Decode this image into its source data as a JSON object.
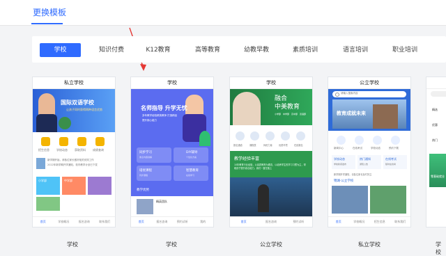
{
  "header": {
    "tab": "更换模板"
  },
  "filters": [
    "学校",
    "知识付费",
    "K12教育",
    "高等教育",
    "幼教早教",
    "素质培训",
    "语言培训",
    "职业培训"
  ],
  "cards": [
    {
      "title": "私立学校",
      "banner_title": "国际双语学校",
      "banner_sub": "让孩子同时获得两种语言优势",
      "icons": [
        "招生信息",
        "学校动态",
        "获取资料",
        "成绩查询"
      ],
      "news_line1": "新学期开始，请各位家长做好相关安排工作",
      "news_line2": "2022年新学期开学通知，校内教学计划已下发",
      "tiles": [
        "小学部",
        "中学部",
        "",
        ""
      ],
      "nav": [
        "首页",
        "学校概况",
        "报名咨询",
        "联系我们"
      ]
    },
    {
      "title": "学校",
      "banner_title": "名师指导 升学无忧",
      "banner_sub1": "多年教学经验精英教师 打造精品",
      "banner_sub2": "提升核心能力",
      "grid": [
        "同步学习",
        "DIY辅导",
        "培优课程",
        "智慧教育"
      ],
      "grid_sub": [
        "重点内容讲解",
        "个性化方案",
        "同步课程",
        "在线学习"
      ],
      "section": "教学优势",
      "team": "精英团队",
      "nav": [
        "首页",
        "报名咨询",
        "预约试听",
        "我的"
      ]
    },
    {
      "title": "学校",
      "banner_big1": "融合",
      "banner_big2": "中美教育",
      "banner_tags": [
        "小学部",
        "中学部",
        "高中部",
        "双语部"
      ],
      "icons": [
        "报名通道",
        "课程表",
        "师资力量",
        "优质环境",
        "在线报名"
      ],
      "section": "教学经验丰富",
      "section_text": "10年教育行业经验，以素质教育为理念，以培养学生的学习习惯为主，帮助孩子提升综合能力，我们一直在路上",
      "nav": [
        "首页",
        "报名咨询",
        "预约试听"
      ]
    },
    {
      "title": "公立学校",
      "search": "请输入搜索内容",
      "banner": "教育成就未来",
      "icons": [
        "新闻中心",
        "在线考试",
        "学校动态",
        "预约下载"
      ],
      "tiles": [
        "学校动态",
        "热门通知",
        "在线考试"
      ],
      "tiles_sub": [
        "学校新闻发布",
        "通知公告",
        "随时在线考"
      ],
      "notice": "新学期开学通知，请各位家长及时关注",
      "section": "锦湖·公立学校",
      "nav": [
        "首页",
        "学校概况",
        "招生信息",
        "联系我们"
      ]
    },
    {
      "title": "",
      "labels": [
        "精选",
        "优惠",
        "热门",
        "零基础就业"
      ]
    }
  ],
  "bottom_row": [
    "学校",
    "学校",
    "公立学校",
    "私立学校",
    "学校"
  ]
}
